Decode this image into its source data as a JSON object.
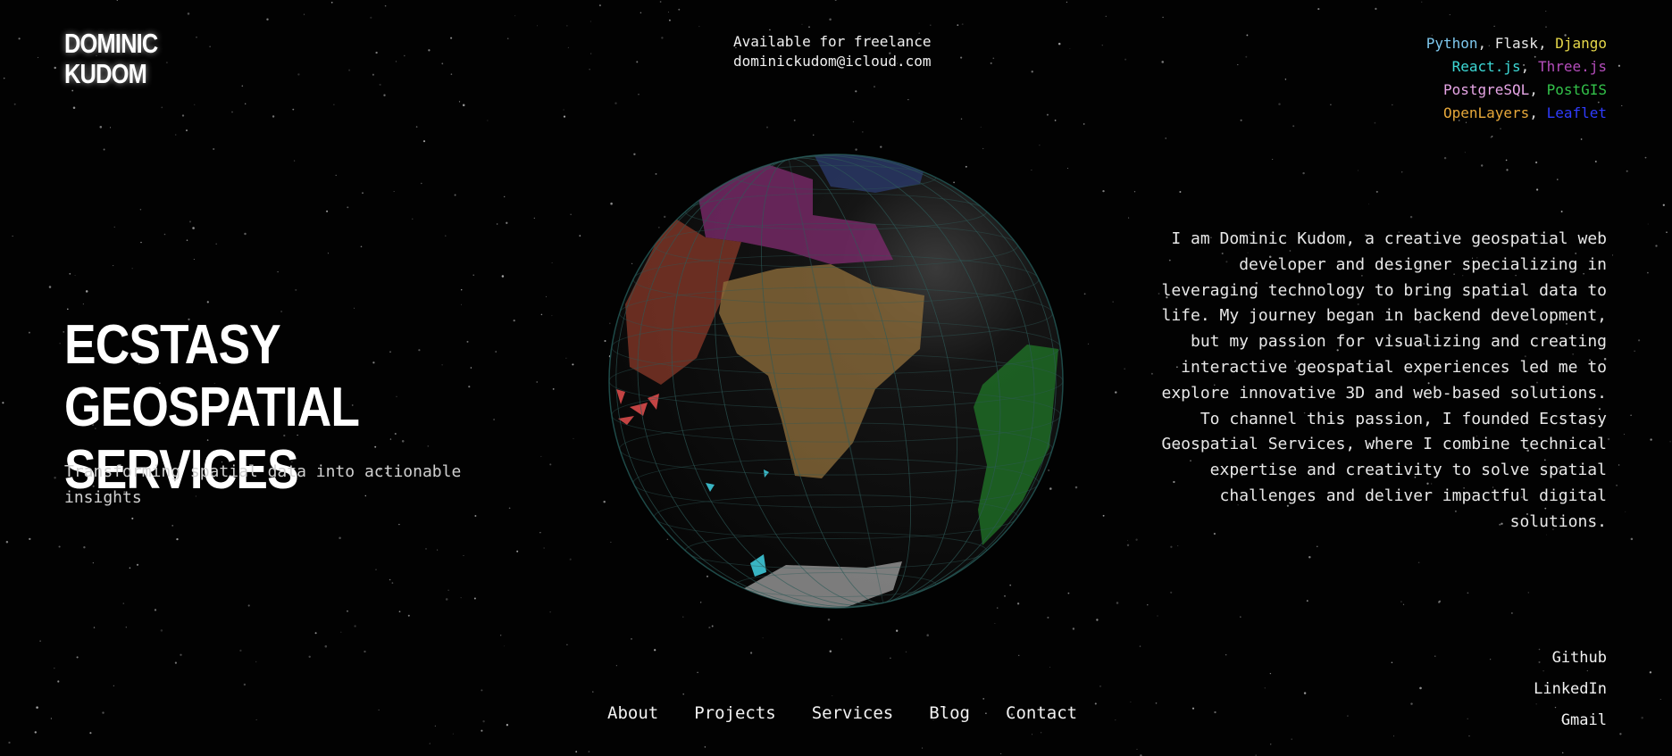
{
  "logo": {
    "line1": "DOMINIC",
    "line2": "KUDOM"
  },
  "contact": {
    "availability": "Available for freelance",
    "email": "dominickudom@icloud.com"
  },
  "tech_stack": [
    [
      {
        "text": "Python",
        "color": "#7ec8ee"
      },
      {
        "text": ", ",
        "color": "#dddddd"
      },
      {
        "text": "Flask",
        "color": "#e8e8e8"
      },
      {
        "text": ", ",
        "color": "#dddddd"
      },
      {
        "text": "Django",
        "color": "#e6d84a"
      }
    ],
    [
      {
        "text": "React.js",
        "color": "#3dd9d6"
      },
      {
        "text": ", ",
        "color": "#dddddd"
      },
      {
        "text": "Three.js",
        "color": "#b44dbb"
      }
    ],
    [
      {
        "text": "PostgreSQL",
        "color": "#e7a6e6"
      },
      {
        "text": ", ",
        "color": "#dddddd"
      },
      {
        "text": "PostGIS",
        "color": "#33c24a"
      }
    ],
    [
      {
        "text": "OpenLayers",
        "color": "#e7a83a"
      },
      {
        "text": ", ",
        "color": "#dddddd"
      },
      {
        "text": "Leaflet",
        "color": "#2f3cff"
      }
    ]
  ],
  "hero": {
    "title_line1": "ECSTASY GEOSPATIAL",
    "title_line2": "SERVICES",
    "subtitle": "Transforming spatial data into actionable insights"
  },
  "bio": "I am Dominic Kudom, a creative geospatial web developer and designer specializing in leveraging technology to bring spatial data to life. My journey began in backend development, but my passion for visualizing and creating interactive geospatial experiences led me to explore innovative 3D and web-based solutions. To channel this passion, I founded Ecstasy Geospatial Services, where I combine technical expertise and creativity to solve spatial challenges and deliver impactful digital solutions.",
  "social": {
    "github": "Github",
    "linkedin": "LinkedIn",
    "gmail": "Gmail"
  },
  "nav": {
    "about": "About",
    "projects": "Projects",
    "services": "Services",
    "blog": "Blog",
    "contact": "Contact"
  },
  "colors": {
    "background": "#020202",
    "africa": "#8a6a3a",
    "south_america": "#1f6b26",
    "europe": "#7a2a6a",
    "middle_east": "#8a3a2a",
    "antarctica": "#9a9a9a",
    "greenland": "#2a3a6a",
    "islands_cyan": "#3ec8d8",
    "islands_red": "#d84a4a"
  }
}
